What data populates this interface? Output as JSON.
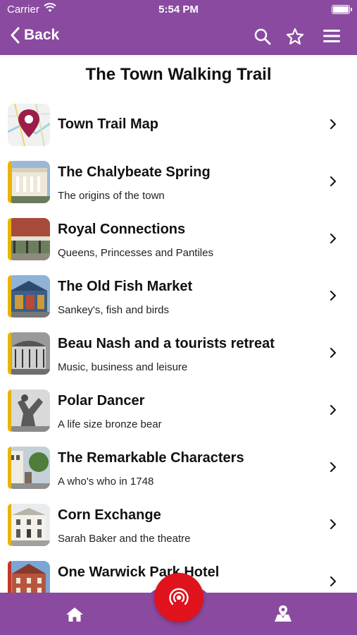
{
  "status": {
    "carrier": "Carrier",
    "time": "5:54 PM"
  },
  "navbar": {
    "back_label": "Back"
  },
  "page_title": "The Town Walking Trail",
  "items": [
    {
      "title": "Town Trail Map",
      "subtitle": "",
      "icon": "map-pin-icon",
      "accent": ""
    },
    {
      "title": "The Chalybeate Spring",
      "subtitle": "The origins of the town",
      "icon": "photo-thumbnail",
      "accent": "#e8b400"
    },
    {
      "title": "Royal Connections",
      "subtitle": "Queens, Princesses and Pantiles",
      "icon": "photo-thumbnail",
      "accent": "#e8b400"
    },
    {
      "title": "The Old Fish Market",
      "subtitle": "Sankey's, fish and birds",
      "icon": "photo-thumbnail",
      "accent": "#e8b400"
    },
    {
      "title": "Beau Nash and a tourists retreat",
      "subtitle": "Music, business and leisure",
      "icon": "photo-thumbnail",
      "accent": "#e8b400"
    },
    {
      "title": "Polar Dancer",
      "subtitle": "A life size bronze bear",
      "icon": "photo-thumbnail",
      "accent": "#e8b400"
    },
    {
      "title": "The Remarkable Characters",
      "subtitle": "A who's who in 1748",
      "icon": "photo-thumbnail",
      "accent": "#e8b400"
    },
    {
      "title": "Corn Exchange",
      "subtitle": "Sarah Baker and the theatre",
      "icon": "photo-thumbnail",
      "accent": "#e8b400"
    },
    {
      "title": "One Warwick Park Hotel",
      "subtitle": "",
      "icon": "photo-thumbnail",
      "accent": "#c0392b"
    }
  ],
  "colors": {
    "brand": "#8a4aa0",
    "accent": "#e8b400",
    "center_button": "#e0121c"
  },
  "tabbar": {
    "left_icon": "home-icon",
    "center_icon": "broadcast-icon",
    "right_icon": "map-icon"
  }
}
